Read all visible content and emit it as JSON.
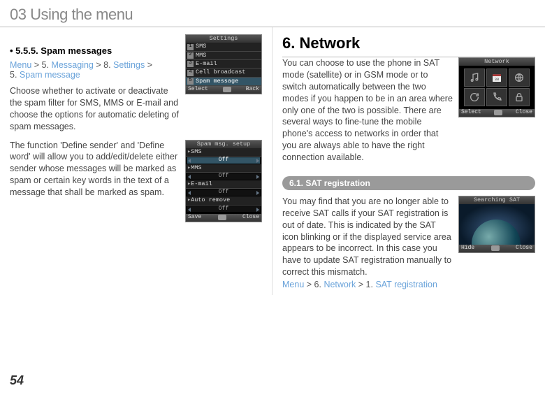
{
  "header": "03 Using the menu",
  "left": {
    "subheading_bullet": "• 5.5.5. Spam messages",
    "breadcrumb": {
      "p1": "Menu",
      "s1": " > 5. ",
      "p2": "Messaging",
      "s2": " > 8. ",
      "p3": "Settings",
      "s3": " > ",
      "line2_pre": "5. ",
      "p4": "Spam message"
    },
    "para1": "Choose whether to activate or deactivate the spam filter for SMS, MMS or E-mail and choose the options for automatic deleting of spam messages.",
    "para2": "The function 'Define sender' and 'Define word' will allow you to add/edit/delete either sender whose messages will be marked as spam or certain key words in the text of a message that shall be marked as spam.",
    "screen1": {
      "title": "Settings",
      "items": [
        "SMS",
        "MMS",
        "E-mail",
        "Cell broadcast",
        "Spam message"
      ],
      "soft_left": "Select",
      "soft_right": "Back"
    },
    "screen2": {
      "title": "Spam msg. setup",
      "labels": [
        "SMS",
        "MMS",
        "E-mail",
        "Auto remove"
      ],
      "value": "Off",
      "soft_left": "Save",
      "soft_right": "Close"
    }
  },
  "right": {
    "section_title": "6. Network",
    "para1": "You can choose to use the phone in SAT mode (satellite) or in GSM mode or to switch automatically between the two modes if you happen to be in an area where only one of the two is possible. There are several ways to fine-tune the mobile phone's access to networks in order that you are always able to have the right connection available.",
    "pill": "6.1. SAT registration",
    "para2": "You may find that you are no longer able to receive SAT calls if your SAT registration is out of date. This is indicated by the SAT icon blinking or if the displayed service area appears to be incorrect. In this case you have to update SAT registration manually to correct this mismatch.",
    "breadcrumb2": {
      "p1": "Menu",
      "s1": " > 6. ",
      "p2": "Network",
      "s2": " > 1. ",
      "p3": "SAT registration"
    },
    "screen3": {
      "title": "Network",
      "soft_left": "Select",
      "soft_right": "Close"
    },
    "screen4": {
      "title": "Searching SAT",
      "soft_left": "Hide",
      "soft_right": "Close"
    }
  },
  "page_number": "54"
}
